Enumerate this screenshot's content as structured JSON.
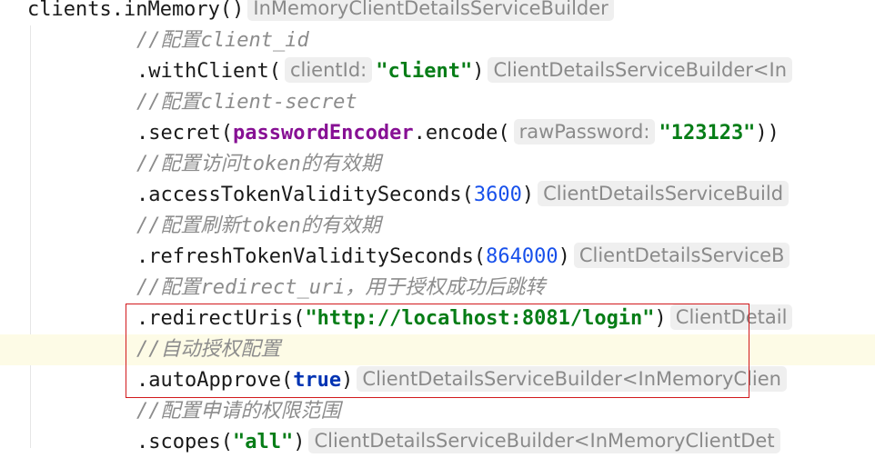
{
  "code": {
    "line0_call": "clients.inMemory()",
    "line0_hint": "InMemoryClientDetailsServiceBuilder",
    "line1_comment": "//配置client_id",
    "line2_method": ".withClient(",
    "line2_param_hint": "clientId:",
    "line2_arg": "\"client\"",
    "line2_close": ")",
    "line2_hint": "ClientDetailsServiceBuilder<In",
    "line3_comment": "//配置client-secret",
    "line4_method": ".secret(",
    "line4_field": "passwordEncoder",
    "line4_call": ".encode(",
    "line4_param_hint": "rawPassword:",
    "line4_arg": "\"123123\"",
    "line4_close": "))",
    "line5_comment": "//配置访问token的有效期",
    "line6_method": ".accessTokenValiditySeconds(",
    "line6_arg": "3600",
    "line6_close": ")",
    "line6_hint": "ClientDetailsServiceBuild",
    "line7_comment": "//配置刷新token的有效期",
    "line8_method": ".refreshTokenValiditySeconds(",
    "line8_arg": "864000",
    "line8_close": ")",
    "line8_hint": "ClientDetailsServiceB",
    "line9_comment": "//配置redirect_uri，用于授权成功后跳转",
    "line10_method": ".redirectUris(",
    "line10_arg": "\"http://localhost:8081/login\"",
    "line10_close": ")",
    "line10_hint": "ClientDetail",
    "line11_comment": "//自动授权配置",
    "line12_method": ".autoApprove(",
    "line12_arg": "true",
    "line12_close": ")",
    "line12_hint": "ClientDetailsServiceBuilder<InMemoryClien",
    "line13_comment": "//配置申请的权限范围",
    "line14_method": ".scopes(",
    "line14_arg": "\"all\"",
    "line14_close": ")",
    "line14_hint": "ClientDetailsServiceBuilder<InMemoryClientDet"
  },
  "colors": {
    "comment": "#8c8c8c",
    "string": "#067d17",
    "number": "#1750eb",
    "keyword": "#0033b3",
    "field": "#871094",
    "highlight_line": "#fdfbe6",
    "callout_border": "#d2191c"
  }
}
